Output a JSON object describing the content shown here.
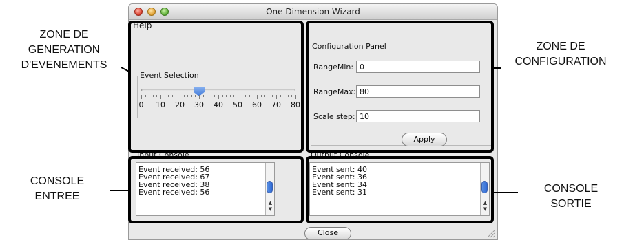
{
  "window": {
    "title": "One Dimension Wizard",
    "menu": "Help",
    "close_label": "Close"
  },
  "event_generation": {
    "group_title": "Event Selection",
    "slider": {
      "value": 30,
      "min": 0,
      "max": 80
    },
    "tick_labels": [
      "0",
      "10",
      "20",
      "30",
      "40",
      "50",
      "60",
      "70",
      "80"
    ]
  },
  "config_panel": {
    "title": "Configuration Panel",
    "range_min_label": "RangeMin:",
    "range_min_value": "0",
    "range_max_label": "RangeMax:",
    "range_max_value": "80",
    "scale_step_label": "Scale step:",
    "scale_step_value": "10",
    "apply_label": "Apply"
  },
  "input_console": {
    "title": "Input Console",
    "lines": [
      "Event received: 56",
      "Event received: 67",
      "Event received: 38",
      "Event received: 56"
    ]
  },
  "output_console": {
    "title": "Output Console",
    "lines": [
      "Event sent: 40",
      "Event sent: 36",
      "Event sent: 34",
      "Event sent: 31"
    ]
  },
  "annotations": {
    "zone_generation": [
      "ZONE DE",
      "GENERATION",
      "D'EVENEMENTS"
    ],
    "zone_configuration": [
      "ZONE DE",
      "CONFIGURATION"
    ],
    "console_entree": [
      "CONSOLE",
      "ENTREE"
    ],
    "console_sortie": [
      "CONSOLE",
      "SORTIE"
    ]
  },
  "colors": {
    "callout": "#000000",
    "window_bg": "#e9e9e9",
    "slider_thumb": "#3f78d8"
  }
}
